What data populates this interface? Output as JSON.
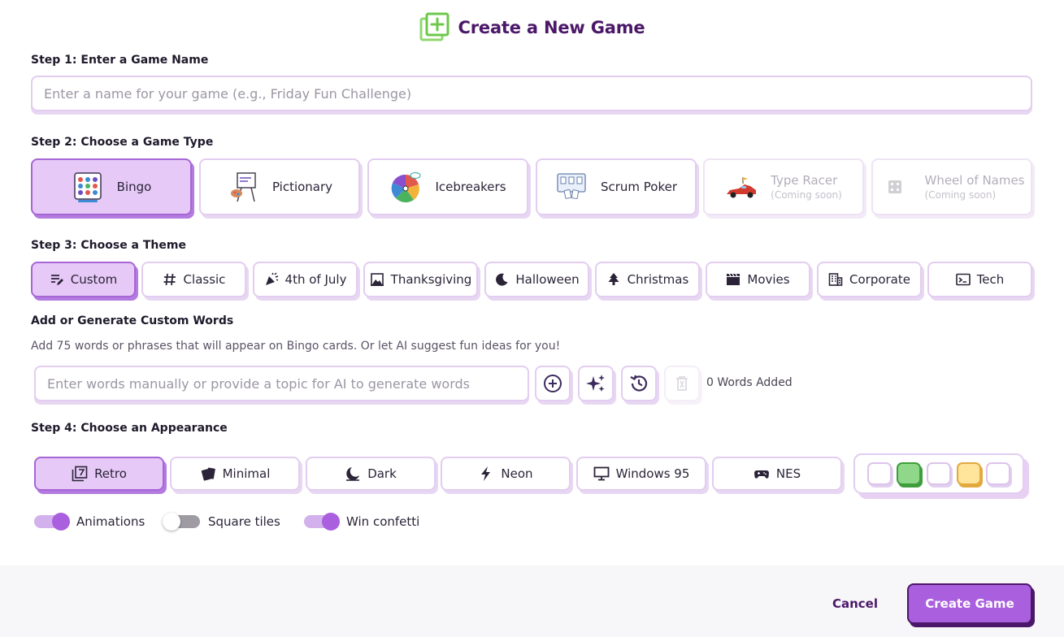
{
  "header": {
    "title": "Create a New Game",
    "logo_icon": "plus-square-icon"
  },
  "step1": {
    "label": "Step 1: Enter a Game Name",
    "placeholder": "Enter a name for your game (e.g., Friday Fun Challenge)",
    "value": ""
  },
  "step2": {
    "label": "Step 2: Choose a Game Type",
    "types": [
      {
        "name": "Bingo",
        "subtitle": "",
        "icon": "bingo-card-icon",
        "selected": true,
        "disabled": false
      },
      {
        "name": "Pictionary",
        "subtitle": "",
        "icon": "easel-icon",
        "selected": false,
        "disabled": false
      },
      {
        "name": "Icebreakers",
        "subtitle": "",
        "icon": "spinner-wheel-icon",
        "selected": false,
        "disabled": false
      },
      {
        "name": "Scrum Poker",
        "subtitle": "",
        "icon": "poker-cards-icon",
        "selected": false,
        "disabled": false
      },
      {
        "name": "Type Racer",
        "subtitle": "(Coming soon)",
        "icon": "race-car-icon",
        "selected": false,
        "disabled": true
      },
      {
        "name": "Wheel of Names",
        "subtitle": "(Coming soon)",
        "icon": "dice-icon",
        "selected": false,
        "disabled": true
      }
    ]
  },
  "step3": {
    "label": "Step 3: Choose a Theme",
    "themes": [
      {
        "name": "Custom",
        "icon": "edit-list-icon",
        "selected": true
      },
      {
        "name": "Classic",
        "icon": "hash-icon",
        "selected": false
      },
      {
        "name": "4th of July",
        "icon": "party-popper-icon",
        "selected": false
      },
      {
        "name": "Thanksgiving",
        "icon": "landscape-icon",
        "selected": false
      },
      {
        "name": "Halloween",
        "icon": "moon-icon",
        "selected": false
      },
      {
        "name": "Christmas",
        "icon": "tree-icon",
        "selected": false
      },
      {
        "name": "Movies",
        "icon": "clapperboard-icon",
        "selected": false
      },
      {
        "name": "Corporate",
        "icon": "building-icon",
        "selected": false
      },
      {
        "name": "Tech",
        "icon": "terminal-icon",
        "selected": false
      }
    ]
  },
  "words": {
    "title": "Add or Generate Custom Words",
    "description": "Add 75 words or phrases that will appear on Bingo cards. Or let AI suggest fun ideas for you!",
    "placeholder": "Enter words manually or provide a topic for AI to generate words",
    "value": "",
    "count_label": "0 Words Added",
    "buttons": [
      {
        "icon": "add-circle-icon",
        "disabled": false
      },
      {
        "icon": "sparkles-icon",
        "disabled": false
      },
      {
        "icon": "history-icon",
        "disabled": false
      },
      {
        "icon": "trash-icon",
        "disabled": true
      }
    ]
  },
  "step4": {
    "label": "Step 4: Choose an Appearance",
    "appearances": [
      {
        "name": "Retro",
        "icon": "retro-frame-icon",
        "selected": true
      },
      {
        "name": "Minimal",
        "icon": "cards-icon",
        "selected": false
      },
      {
        "name": "Dark",
        "icon": "dark-mode-icon",
        "selected": false
      },
      {
        "name": "Neon",
        "icon": "bolt-icon",
        "selected": false
      },
      {
        "name": "Windows 95",
        "icon": "monitor-icon",
        "selected": false
      },
      {
        "name": "NES",
        "icon": "gamepad-icon",
        "selected": false
      }
    ],
    "swatches": [
      {
        "color": "#ffffff",
        "border": "#dcc4ea",
        "selected": false
      },
      {
        "color": "#8fd889",
        "border": "#3f9e3c",
        "selected": true
      },
      {
        "color": "#ffffff",
        "border": "#dcc4ea",
        "selected": false
      },
      {
        "color": "#ffe49b",
        "border": "#e2a93f",
        "selected": false
      },
      {
        "color": "#ffffff",
        "border": "#dcc4ea",
        "selected": false
      }
    ]
  },
  "toggles": [
    {
      "label": "Animations",
      "on": true
    },
    {
      "label": "Square tiles",
      "on": false
    },
    {
      "label": "Win confetti",
      "on": true
    }
  ],
  "footer": {
    "cancel_label": "Cancel",
    "create_label": "Create Game"
  },
  "colors": {
    "accent": "#a95fde",
    "accent_dark": "#4b1869",
    "selected_bg": "#e6c9f6",
    "border": "#e3cdf0"
  }
}
